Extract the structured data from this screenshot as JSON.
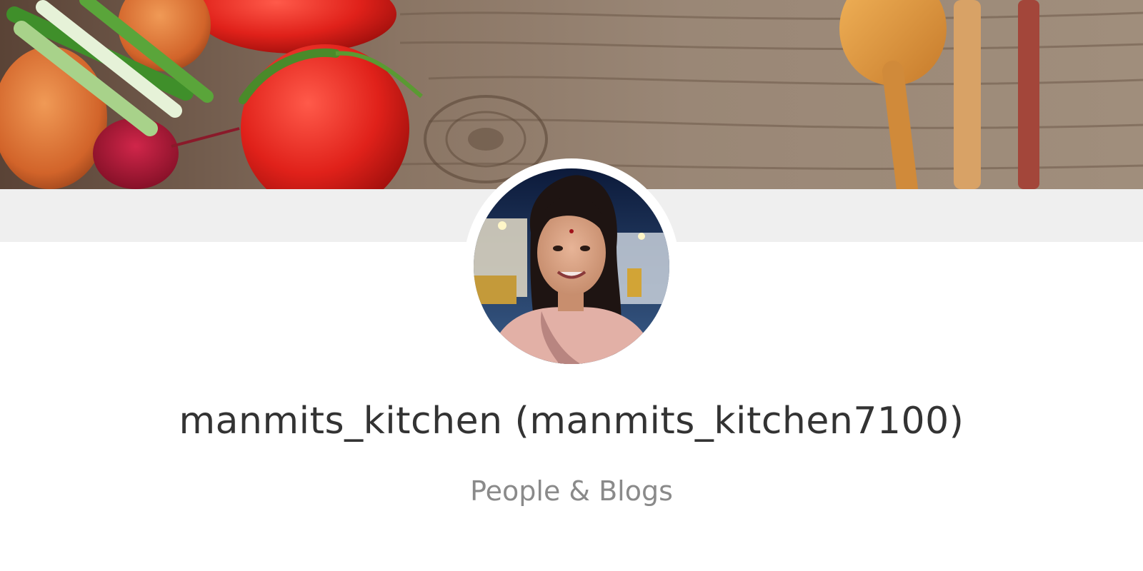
{
  "profile": {
    "cover_image": "kitchen-vegetables-wood-cover",
    "avatar_image": "profile-photo-woman",
    "display_name": "manmits_kitchen",
    "handle": "(manmits_kitchen7100)",
    "full_title": "manmits_kitchen (manmits_kitchen7100)",
    "category": "People & Blogs"
  },
  "colors": {
    "name_text": "#333333",
    "category_text": "#8a8a8a",
    "band": "#efefef",
    "background": "#ffffff"
  }
}
